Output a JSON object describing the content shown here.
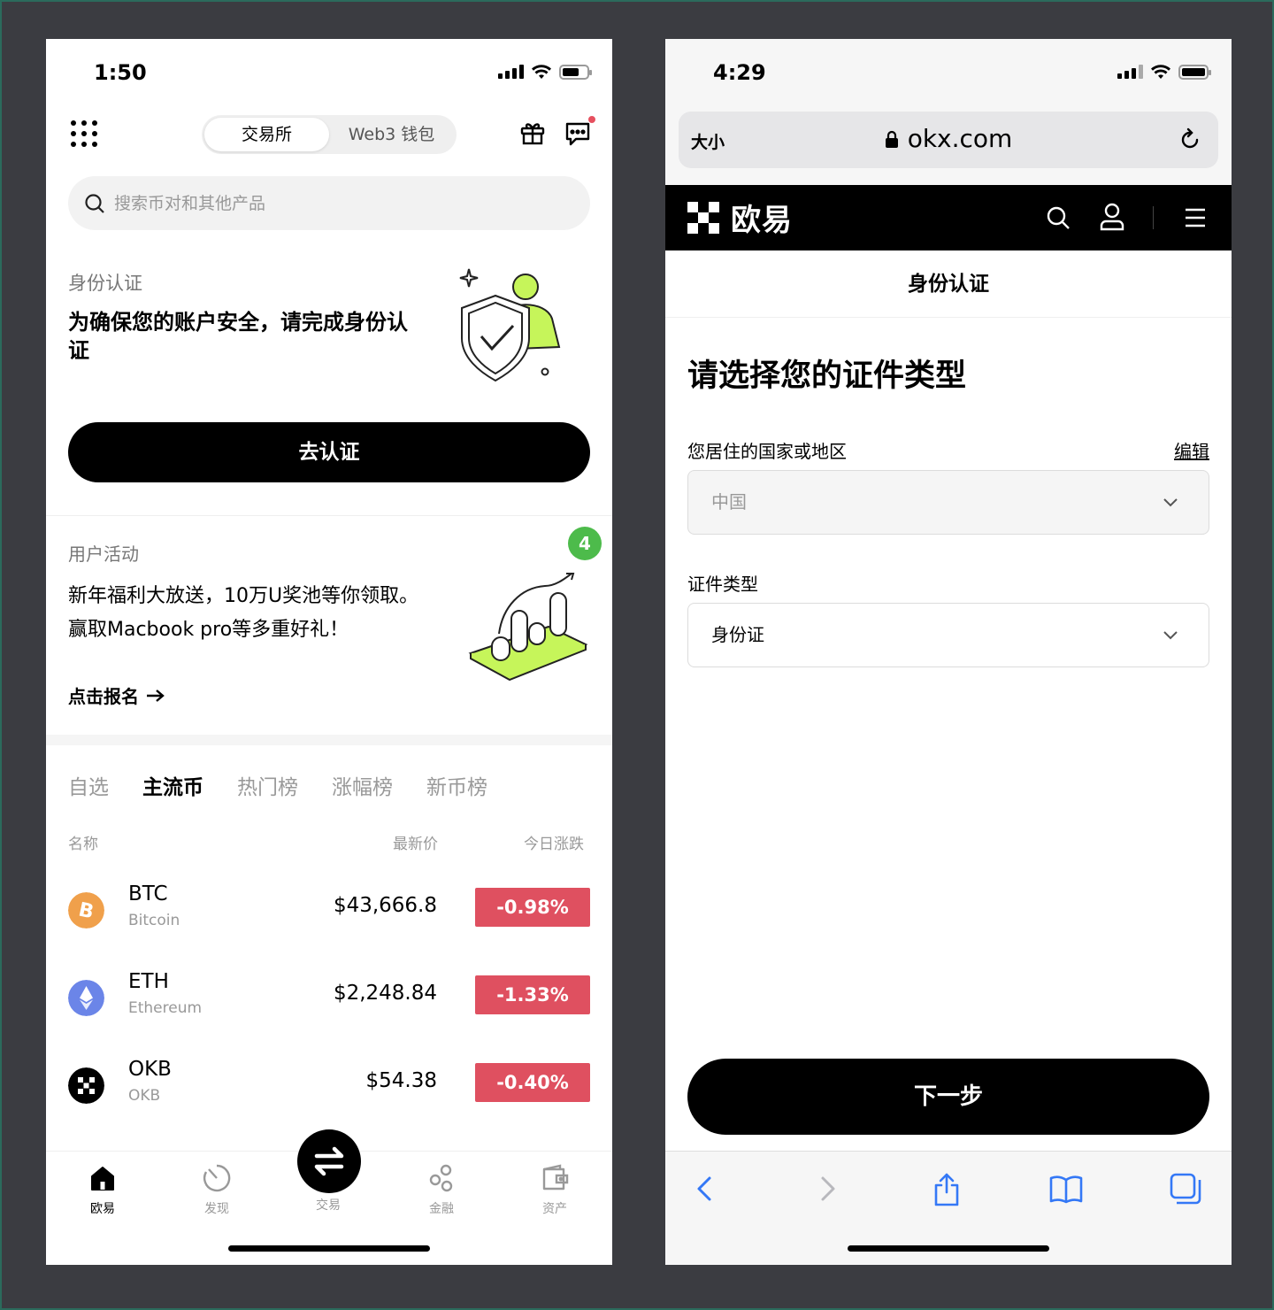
{
  "left_phone": {
    "status": {
      "time": "1:50"
    },
    "header": {
      "segments": [
        {
          "label": "交易所",
          "active": true
        },
        {
          "label": "Web3 钱包",
          "active": false
        }
      ]
    },
    "search": {
      "placeholder": "搜索币对和其他产品"
    },
    "kyc": {
      "label": "身份认证",
      "title": "为确保您的账户安全，请完成身份认证",
      "button": "去认证"
    },
    "activity": {
      "label": "用户活动",
      "title": "新年福利大放送，10万U奖池等你领取。赢取Macbook pro等多重好礼！",
      "link": "点击报名",
      "badge": "4"
    },
    "market_tabs": [
      "自选",
      "主流币",
      "热门榜",
      "涨幅榜",
      "新币榜"
    ],
    "market_active_tab": "主流币",
    "columns": {
      "name": "名称",
      "price": "最新价",
      "change": "今日涨跌"
    },
    "coins": [
      {
        "symbol": "BTC",
        "name": "Bitcoin",
        "price": "$43,666.8",
        "change": "-0.98%",
        "icon": "bitcoin-icon",
        "color": "#f7931a"
      },
      {
        "symbol": "ETH",
        "name": "Ethereum",
        "price": "$2,248.84",
        "change": "-1.33%",
        "icon": "ethereum-icon",
        "color": "#627eea"
      },
      {
        "symbol": "OKB",
        "name": "OKB",
        "price": "$54.38",
        "change": "-0.40%",
        "icon": "okb-icon",
        "color": "#000000"
      }
    ],
    "tabbar": [
      {
        "label": "欧易",
        "icon": "home-icon",
        "active": true
      },
      {
        "label": "发现",
        "icon": "discover-icon",
        "active": false
      },
      {
        "label": "交易",
        "icon": "trade-icon",
        "active": false
      },
      {
        "label": "金融",
        "icon": "finance-icon",
        "active": false
      },
      {
        "label": "资产",
        "icon": "wallet-icon",
        "active": false
      }
    ]
  },
  "right_phone": {
    "status": {
      "time": "4:29"
    },
    "browser": {
      "text_size_label": "大小",
      "url": "okx.com"
    },
    "nav": {
      "brand": "欧易"
    },
    "page_title": "身份认证",
    "heading": "请选择您的证件类型",
    "country": {
      "label": "您居住的国家或地区",
      "edit": "编辑",
      "value": "中国"
    },
    "doc_type": {
      "label": "证件类型",
      "value": "身份证"
    },
    "next_button": "下一步"
  },
  "colors": {
    "accent_lime": "#c6f55a",
    "negative_red": "#df5060",
    "badge_green": "#4dbb4b",
    "safari_blue": "#3478f6"
  }
}
